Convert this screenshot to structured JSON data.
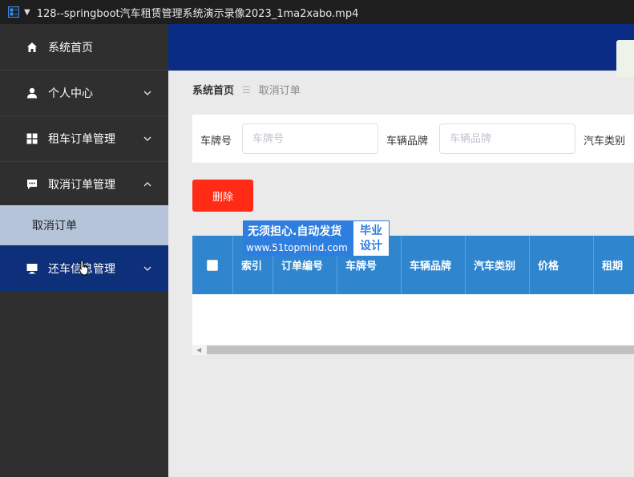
{
  "window": {
    "title": "128--springboot汽车租赁管理系统演示录像2023_1ma2xabo.mp4"
  },
  "sidebar": {
    "items": [
      {
        "label": "系统首页",
        "icon": "home-icon"
      },
      {
        "label": "个人中心",
        "icon": "user-icon"
      },
      {
        "label": "租车订单管理",
        "icon": "grid-icon"
      },
      {
        "label": "取消订单管理",
        "icon": "message-icon"
      },
      {
        "label": "还车信息管理",
        "icon": "monitor-icon"
      }
    ],
    "submenu": {
      "label": "取消订单"
    }
  },
  "breadcrumb": {
    "home": "系统首页",
    "current": "取消订单"
  },
  "search": {
    "plate_label": "车牌号",
    "plate_placeholder": "车牌号",
    "brand_label": "车辆品牌",
    "brand_placeholder": "车辆品牌",
    "type_label": "汽车类别"
  },
  "toolbar": {
    "delete_label": "删除"
  },
  "table": {
    "columns": [
      "索引",
      "订单编号",
      "车牌号",
      "车辆品牌",
      "汽车类别",
      "价格",
      "租期"
    ],
    "rows": []
  },
  "watermark": {
    "slogan": "无须担心.自动发货",
    "url": "www.51topmind.com",
    "badge_line1": "毕业",
    "badge_line2": "设计"
  },
  "colors": {
    "sidebar": "#2f2f2f",
    "topbar": "#0a2c84",
    "table_header": "#2f86cf",
    "delete_button": "#ff2b14",
    "submenu_active": "#b5c4d9"
  }
}
